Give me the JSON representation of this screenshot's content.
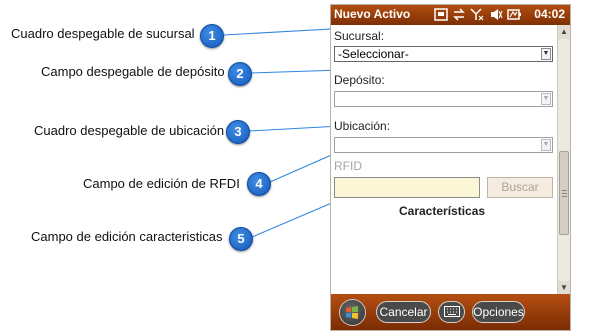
{
  "callouts": [
    {
      "num": "1",
      "label": "Cuadro despegable de sucursal"
    },
    {
      "num": "2",
      "label": "Campo despegable de depósito"
    },
    {
      "num": "3",
      "label": "Cuadro despegable de ubicación"
    },
    {
      "num": "4",
      "label": "Campo de edición de RFDI"
    },
    {
      "num": "5",
      "label": "Campo de edición caracteristicas"
    }
  ],
  "titlebar": {
    "title": "Nuevo Activo",
    "time": "04:02",
    "icons": [
      "window-icon",
      "sync-arrows-icon",
      "signal-off-icon",
      "volume-icon",
      "battery-icon"
    ]
  },
  "form": {
    "sucursal_label": "Sucursal:",
    "sucursal_value": "-Seleccionar-",
    "deposito_label": "Depósito:",
    "deposito_value": "",
    "ubicacion_label": "Ubicación:",
    "ubicacion_value": "",
    "rfid_label": "RFID",
    "rfid_value": "",
    "buscar_label": "Buscar",
    "caracteristicas_label": "Características"
  },
  "softbar": {
    "cancelar_label": "Cancelar",
    "opciones_label": "Opciones"
  },
  "colors": {
    "badge": "#1f6ed4",
    "titlebar": "#9a3e0a",
    "callout_line": "#2f86e0"
  }
}
